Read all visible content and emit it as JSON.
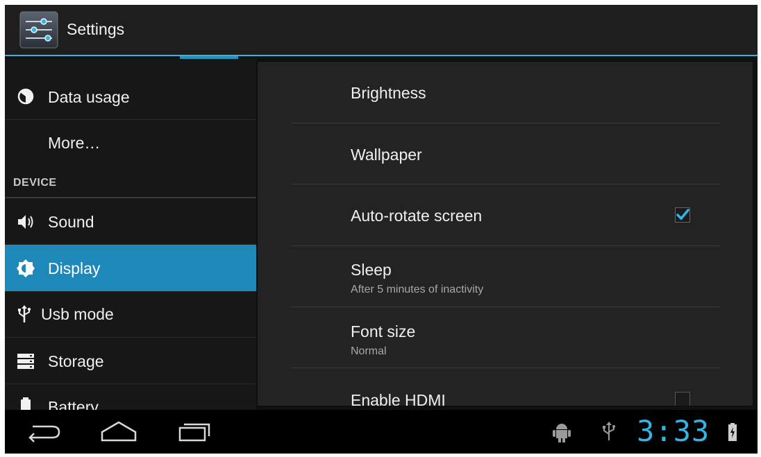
{
  "app": {
    "title": "Settings",
    "icon": "settings-sliders-icon"
  },
  "sidebar": {
    "items": [
      {
        "label": "Data usage",
        "icon": "data-usage-icon"
      },
      {
        "label": "More…",
        "icon": ""
      },
      {
        "label": "Sound",
        "icon": "speaker-icon"
      },
      {
        "label": "Display",
        "icon": "brightness-icon",
        "selected": true
      },
      {
        "label": "Usb mode",
        "icon": "usb-icon"
      },
      {
        "label": "Storage",
        "icon": "storage-icon"
      },
      {
        "label": "Battery",
        "icon": "battery-icon"
      }
    ],
    "section_device": "DEVICE"
  },
  "display": {
    "prefs": [
      {
        "title": "Brightness"
      },
      {
        "title": "Wallpaper"
      },
      {
        "title": "Auto-rotate screen",
        "checked": true
      },
      {
        "title": "Sleep",
        "summary": "After 5 minutes of inactivity"
      },
      {
        "title": "Font size",
        "summary": "Normal"
      },
      {
        "title": "Enable HDMI",
        "checked": false
      }
    ]
  },
  "status": {
    "time": "3:33",
    "icons": [
      "android-debug-icon",
      "usb-icon",
      "battery-charging-icon"
    ]
  },
  "nav": {
    "icons": [
      "back-icon",
      "home-icon",
      "recent-apps-icon"
    ]
  },
  "colors": {
    "accent": "#33b5e5",
    "selected_bg": "#1e89b8",
    "background": "#111111"
  }
}
